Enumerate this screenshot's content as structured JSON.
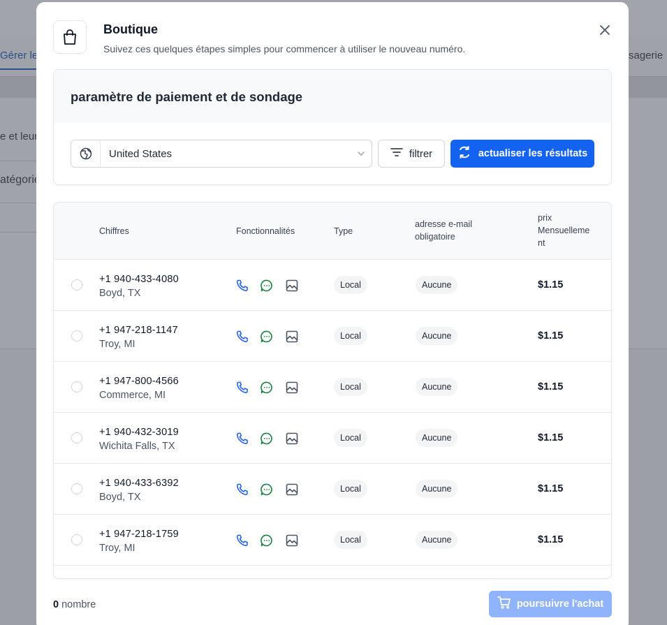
{
  "background": {
    "tab_left": "Gérer les",
    "tab_right": "sagerie",
    "text_1": "e et leurs",
    "text_2": "atégorie"
  },
  "modal": {
    "title": "Boutique",
    "subtitle": "Suivez ces quelques étapes simples pour commencer à utiliser le nouveau numéro.",
    "close_icon": "close-icon"
  },
  "settings": {
    "heading": "paramètre de paiement et de sondage",
    "country": "United States",
    "filter_label": "filtrer",
    "refresh_label": "actualiser les résultats"
  },
  "table": {
    "headers": {
      "numbers": "Chiffres",
      "features": "Fonctionnalités",
      "type": "Type",
      "email_line1": "adresse e-mail",
      "email_line2": "obligatoire",
      "price_line1": "prix",
      "price_line2": "Mensuelleme",
      "price_line3": "nt"
    },
    "rows": [
      {
        "number": "+1 940-433-4080",
        "location": "Boyd, TX",
        "type": "Local",
        "email": "Aucune",
        "price": "$1.15"
      },
      {
        "number": "+1 947-218-1147",
        "location": "Troy, MI",
        "type": "Local",
        "email": "Aucune",
        "price": "$1.15"
      },
      {
        "number": "+1 947-800-4566",
        "location": "Commerce, MI",
        "type": "Local",
        "email": "Aucune",
        "price": "$1.15"
      },
      {
        "number": "+1 940-432-3019",
        "location": "Wichita Falls, TX",
        "type": "Local",
        "email": "Aucune",
        "price": "$1.15"
      },
      {
        "number": "+1 940-433-6392",
        "location": "Boyd, TX",
        "type": "Local",
        "email": "Aucune",
        "price": "$1.15"
      },
      {
        "number": "+1 947-218-1759",
        "location": "Troy, MI",
        "type": "Local",
        "email": "Aucune",
        "price": "$1.15"
      }
    ]
  },
  "footer": {
    "count": "0",
    "count_label": "nombre",
    "buy_label": "poursuivre l'achat"
  },
  "colors": {
    "primary": "#1463f0",
    "primary_disabled": "#8fb4fb",
    "phone_icon": "#2563eb",
    "message_icon": "#15803d",
    "image_icon": "#4b5563"
  }
}
